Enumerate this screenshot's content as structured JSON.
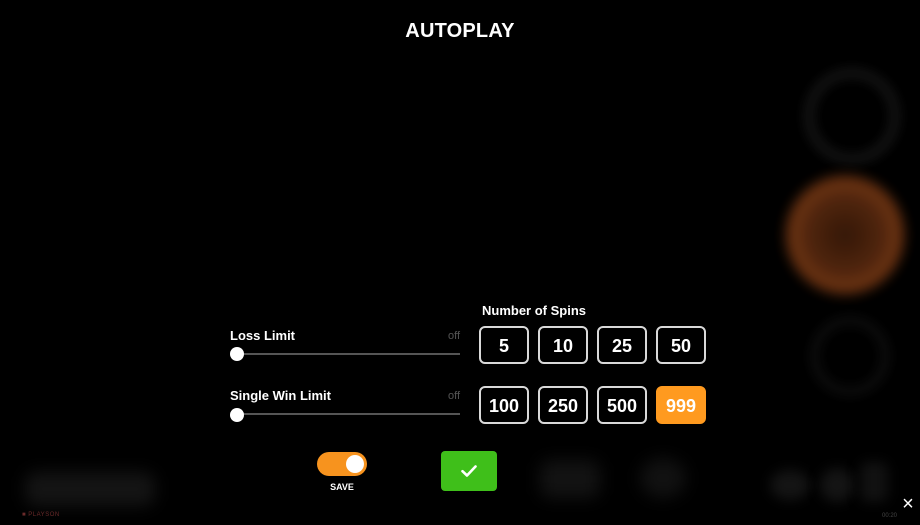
{
  "title": "AUTOPLAY",
  "loss_limit": {
    "label": "Loss Limit",
    "value_text": "off",
    "level": 0
  },
  "single_win_limit": {
    "label": "Single Win Limit",
    "value_text": "off",
    "level": 0
  },
  "number_of_spins": {
    "label": "Number of Spins",
    "options": [
      "5",
      "10",
      "25",
      "50",
      "100",
      "250",
      "500",
      "999"
    ],
    "selected": "999"
  },
  "save": {
    "label": "SAVE",
    "toggle_on": true
  },
  "colors": {
    "accent_orange": "#f7931e",
    "selected_orange": "#ff9a1f",
    "confirm_green": "#3fbf1a"
  },
  "icons": {
    "confirm": "check-icon",
    "close": "close-icon"
  },
  "close_symbol": "×"
}
